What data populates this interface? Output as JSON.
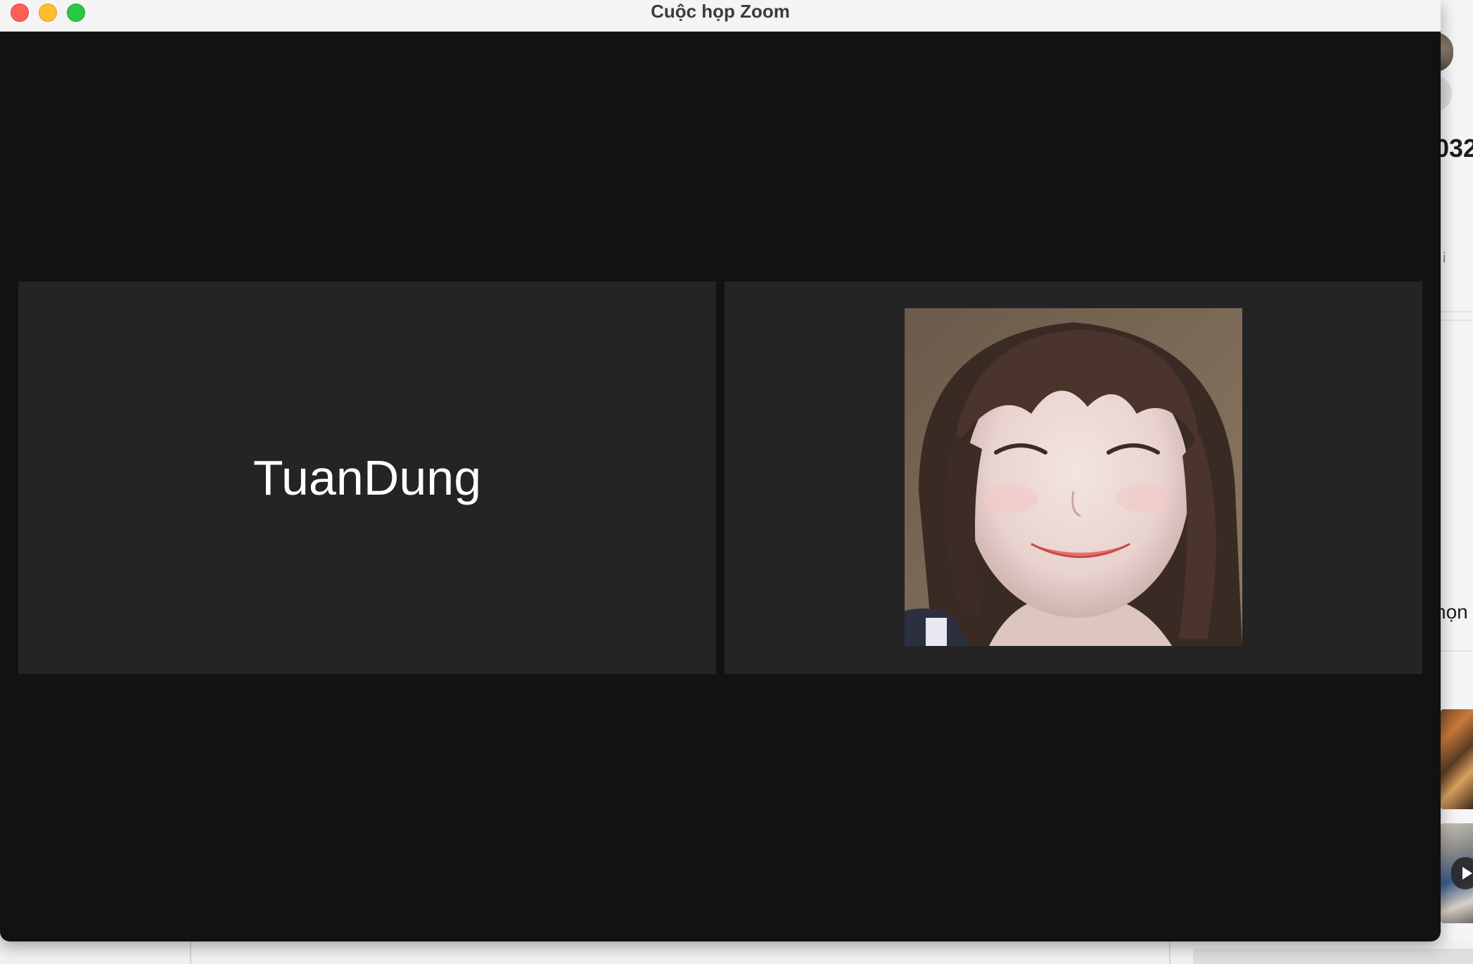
{
  "window": {
    "title": "Cuộc họp Zoom"
  },
  "participants": [
    {
      "name": "TuanDung",
      "video_on": false
    },
    {
      "name": "",
      "video_on": true
    }
  ],
  "background_app": {
    "partial_heading": "032",
    "partial_i": "i",
    "partial_label": "họn"
  }
}
